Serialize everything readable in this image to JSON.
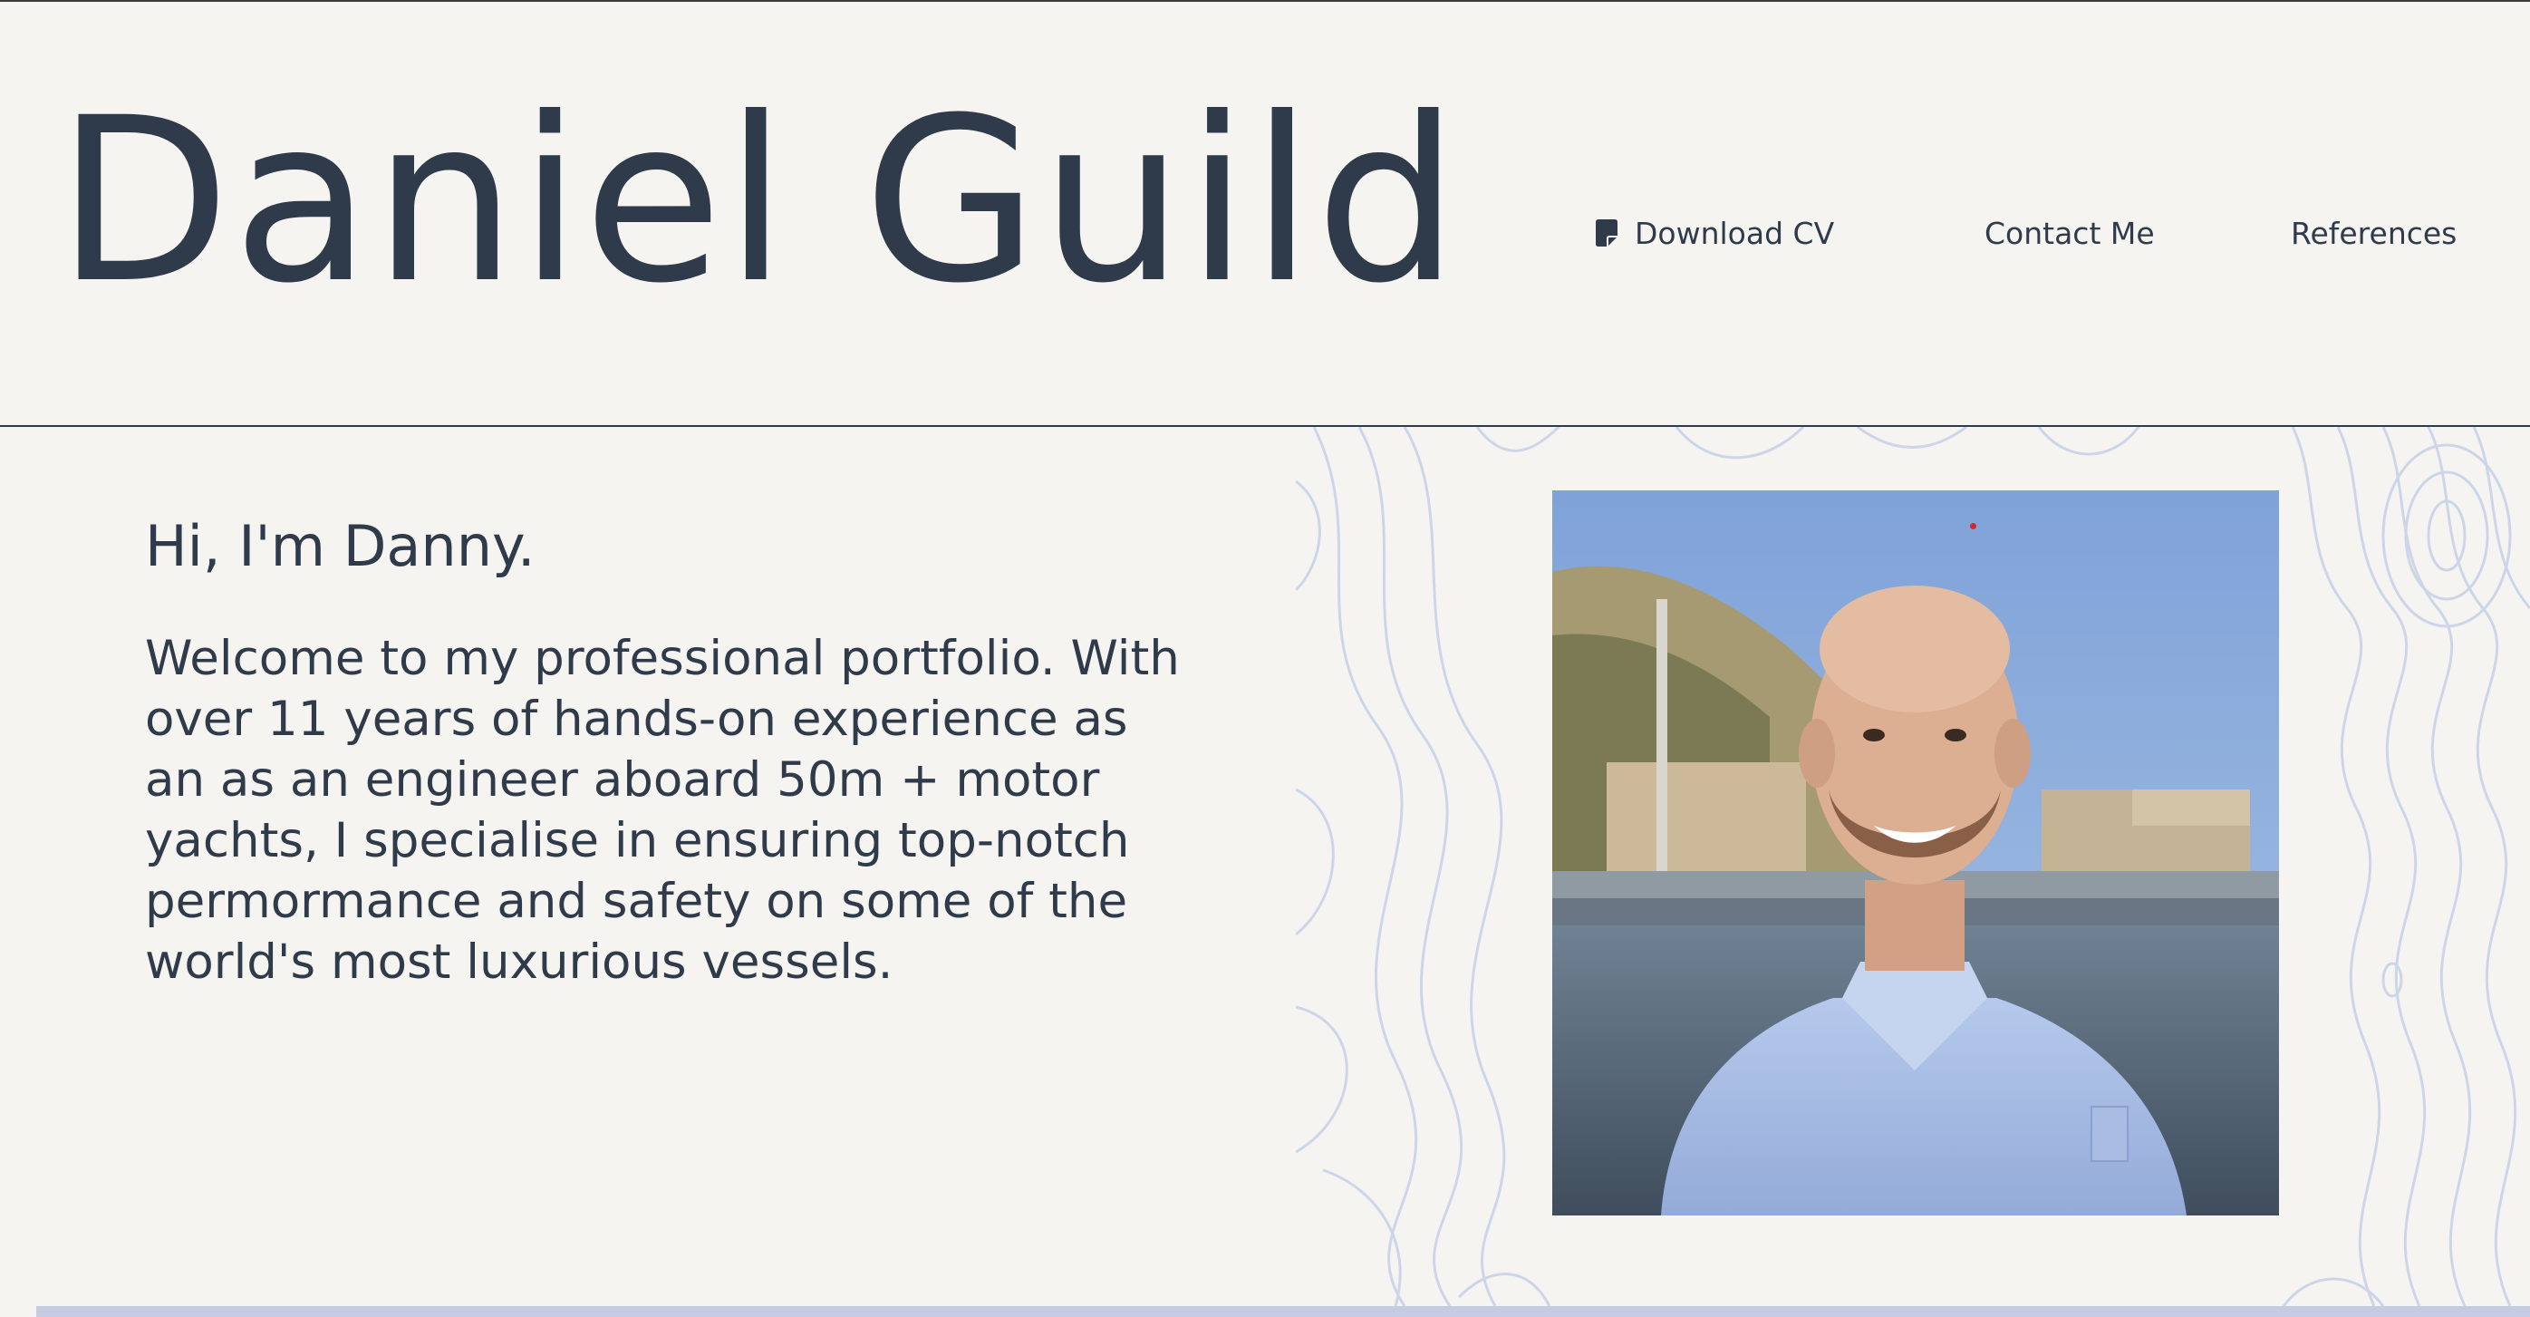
{
  "header": {
    "title": "Daniel Guild",
    "nav": {
      "download_cv": "Download CV",
      "contact": "Contact Me",
      "references": "References"
    }
  },
  "hero": {
    "greeting": "Hi, I'm Danny.",
    "intro": "Welcome to my professional portfolio. With over 11 years of hands-on experience as an as an engineer aboard 50m + motor yachts, I specialise in ensuring top-notch permormance and safety on some of the world's most luxurious vessels."
  },
  "icons": {
    "download": "document-icon"
  },
  "colors": {
    "background": "#f5f4f0",
    "text": "#2f3b4a",
    "accent_band": "#c5cbe0",
    "topo_lines": "#c9d2e6"
  }
}
